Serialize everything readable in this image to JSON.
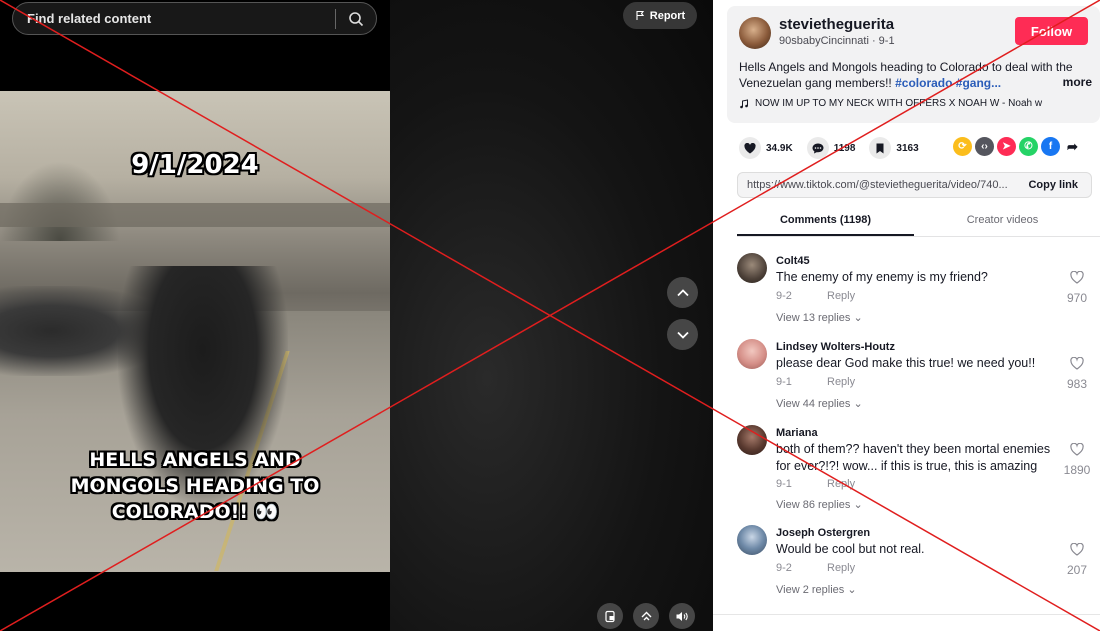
{
  "search": {
    "placeholder": "Find related content"
  },
  "report_label": "Report",
  "video": {
    "date_overlay": "9/1/2024",
    "headline_overlay": "HELLS ANGELS AND MONGOLS HEADING TO COLORADO!! 👀"
  },
  "author": {
    "username": "stevietheguerita",
    "subline": "90sbabyCincinnati · 9-1",
    "follow_label": "Follow"
  },
  "description": {
    "text": "Hells Angels and Mongols heading to Colorado to deal with the Venezuelan gang members!! ",
    "hashtags": "#colorado #gang...",
    "more_label": "more",
    "music": "NOW IM UP TO MY NECK WITH OFFERS X NOAH W - Noah w"
  },
  "stats": {
    "likes": "34.9K",
    "comments": "1198",
    "saves": "3163"
  },
  "link": {
    "url": "https://www.tiktok.com/@stevietheguerita/video/740...",
    "copy_label": "Copy link"
  },
  "tabs": [
    {
      "label": "Comments (1198)",
      "active": true
    },
    {
      "label": "Creator videos",
      "active": false
    }
  ],
  "comments": [
    {
      "name": "Colt45",
      "text": "The enemy of my enemy is my friend?",
      "date": "9-2",
      "reply": "Reply",
      "view_replies": "View 13 replies",
      "likes": "970"
    },
    {
      "name": "Lindsey Wolters-Houtz",
      "text": "please dear God make this true! we need you!!",
      "date": "9-1",
      "reply": "Reply",
      "view_replies": "View 44 replies",
      "likes": "983"
    },
    {
      "name": "Mariana",
      "text": "both of them?? haven't they been mortal enemies for ever?!?! wow... if this is true, this is amazing",
      "date": "9-1",
      "reply": "Reply",
      "view_replies": "View 86 replies",
      "likes": "1890"
    },
    {
      "name": "Joseph Ostergren",
      "text": "Would be cool but not real.",
      "date": "9-2",
      "reply": "Reply",
      "view_replies": "View 2 replies",
      "likes": "207"
    }
  ],
  "colors": {
    "accent": "#fe2c55",
    "hashtag": "#2b5db9",
    "cross": "#e01e1e"
  }
}
